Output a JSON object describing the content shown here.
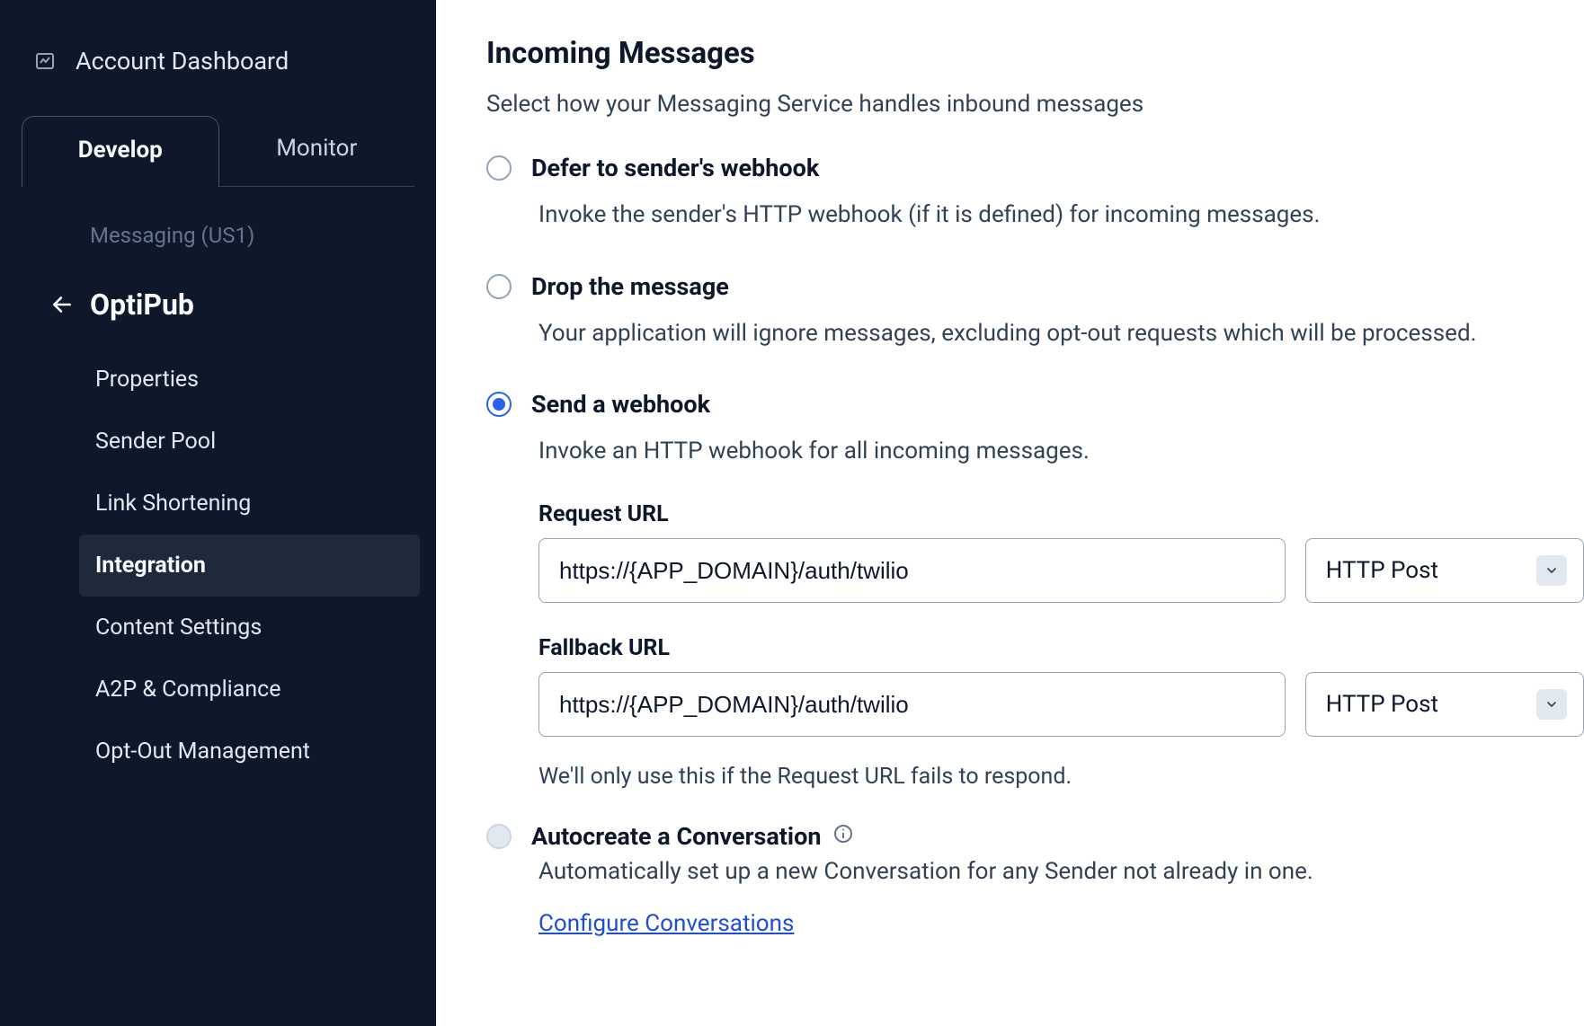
{
  "sidebar": {
    "dashboard_label": "Account Dashboard",
    "tabs": {
      "develop": "Develop",
      "monitor": "Monitor"
    },
    "section_label": "Messaging (US1)",
    "back_label": "OptiPub",
    "nav": [
      "Properties",
      "Sender Pool",
      "Link Shortening",
      "Integration",
      "Content Settings",
      "A2P & Compliance",
      "Opt-Out Management"
    ],
    "active_nav_index": 3
  },
  "main": {
    "title": "Incoming Messages",
    "subtitle": "Select how your Messaging Service handles inbound messages",
    "options": {
      "defer": {
        "label": "Defer to sender's webhook",
        "desc": "Invoke the sender's HTTP webhook (if it is defined) for incoming messages."
      },
      "drop": {
        "label": "Drop the message",
        "desc": "Your application will ignore messages, excluding opt-out requests which will be processed."
      },
      "send": {
        "label": "Send a webhook",
        "desc": "Invoke an HTTP webhook for all incoming messages."
      }
    },
    "selected_option": "send",
    "request_url": {
      "label": "Request URL",
      "value": "https://{APP_DOMAIN}/auth/twilio",
      "method": "HTTP Post"
    },
    "fallback_url": {
      "label": "Fallback URL",
      "value": "https://{APP_DOMAIN}/auth/twilio",
      "method": "HTTP Post",
      "note": "We'll only use this if the Request URL fails to respond."
    },
    "autocreate": {
      "label": "Autocreate a Conversation",
      "desc": "Automatically set up a new Conversation for any Sender not already in one.",
      "link": "Configure Conversations"
    }
  }
}
